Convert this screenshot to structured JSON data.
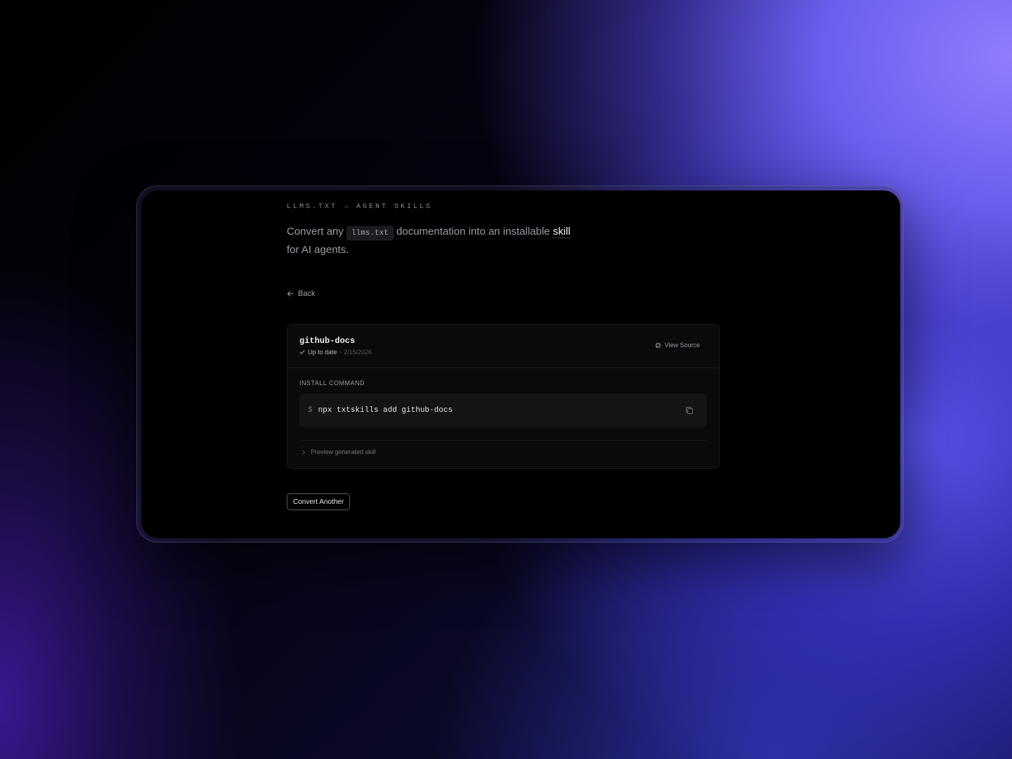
{
  "header": {
    "eyebrow": "LLMS.TXT → AGENT SKILLS",
    "tagline_prefix": "Convert any",
    "tagline_code": "llms.txt",
    "tagline_middle": "documentation into an installable",
    "tagline_highlight": "skill",
    "tagline_suffix": "for AI agents."
  },
  "nav": {
    "back_label": "Back"
  },
  "card": {
    "skill_name": "github-docs",
    "status_label": "Up to date",
    "status_date": "· 2/15/2026",
    "view_source_label": "View Source",
    "install_label": "INSTALL COMMAND",
    "command_prompt": "$",
    "command": "npx txtskills add github-docs",
    "preview_label": "Preview generated skill"
  },
  "actions": {
    "convert_another_label": "Convert Another"
  },
  "icons": {
    "back": "arrow-left-icon",
    "status": "check-icon",
    "view_source": "github-icon",
    "copy": "copy-icon",
    "preview": "chevron-right-icon"
  },
  "colors": {
    "accent_purple": "#6b5ff0",
    "screen_bg": "#000000",
    "card_bg": "#0a0a0b"
  }
}
